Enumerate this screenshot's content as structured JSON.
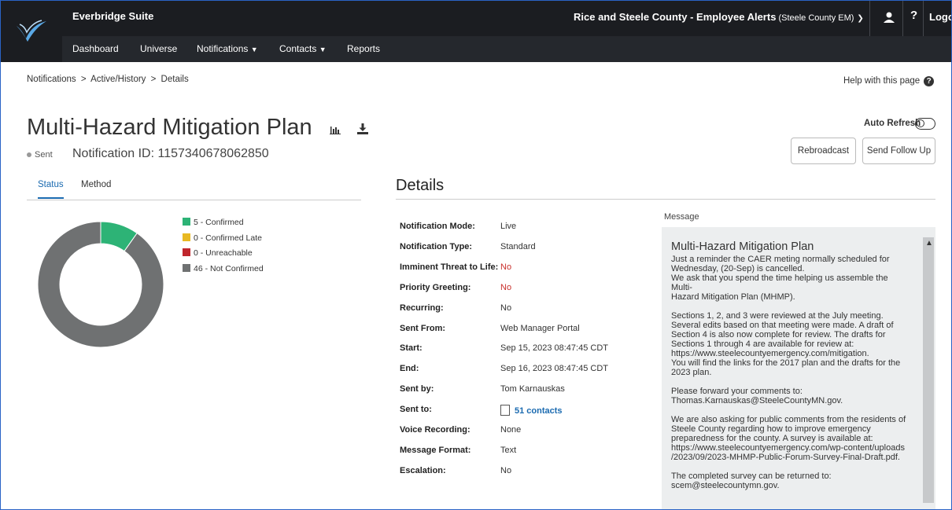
{
  "app": {
    "title": "Everbridge Suite",
    "org_name": "Rice and Steele County - Employee Alerts",
    "org_sub": "(Steele County EM)",
    "help_icon": "?",
    "logout": "Logout"
  },
  "nav": [
    {
      "label": "Dashboard"
    },
    {
      "label": "Universe"
    },
    {
      "label": "Notifications",
      "dropdown": true
    },
    {
      "label": "Contacts",
      "dropdown": true
    },
    {
      "label": "Reports"
    }
  ],
  "breadcrumb": {
    "items": [
      "Notifications",
      "Active/History",
      "Details"
    ],
    "separator": ">"
  },
  "help_page": "Help with this page",
  "header": {
    "title": "Multi-Hazard Mitigation Plan",
    "status": "Sent",
    "notification_id": "Notification ID: 1157340678062850"
  },
  "actions": {
    "auto_refresh": "Auto Refresh",
    "auto_refresh_on": false,
    "rebroadcast": "Rebroadcast",
    "send_follow_up": "Send Follow Up"
  },
  "tabs": {
    "status": "Status",
    "method": "Method"
  },
  "status_chart": {
    "legend": [
      {
        "label": "5 - Confirmed",
        "value": 5,
        "color": "#2db376"
      },
      {
        "label": "0 - Confirmed Late",
        "value": 0,
        "color": "#e8b923"
      },
      {
        "label": "0 - Unreachable",
        "value": 0,
        "color": "#c0262d"
      },
      {
        "label": "46 - Not Confirmed",
        "value": 46,
        "color": "#6f7172"
      }
    ]
  },
  "details": {
    "heading": "Details",
    "rows": [
      {
        "label": "Notification Mode:",
        "value": "Live"
      },
      {
        "label": "Notification Type:",
        "value": "Standard"
      },
      {
        "label": "Imminent Threat to Life:",
        "value": "No",
        "style": "red"
      },
      {
        "label": "Priority Greeting:",
        "value": "No",
        "style": "red"
      },
      {
        "label": "Recurring:",
        "value": "No"
      },
      {
        "label": "Sent From:",
        "value": "Web Manager Portal"
      },
      {
        "label": "Start:",
        "value": "Sep 15, 2023 08:47:45 CDT"
      },
      {
        "label": "End:",
        "value": "Sep 16, 2023 08:47:45 CDT"
      },
      {
        "label": "Sent by:",
        "value": "Tom Karnauskas"
      },
      {
        "label": "Sent to:",
        "value": "51 contacts",
        "style": "link"
      },
      {
        "label": "Voice Recording:",
        "value": "None"
      },
      {
        "label": "Message Format:",
        "value": "Text"
      },
      {
        "label": "Escalation:",
        "value": "No"
      }
    ]
  },
  "message": {
    "label": "Message",
    "title": "Multi-Hazard Mitigation Plan",
    "paragraphs": [
      "Just a reminder the CAER meting normally scheduled for\nWednesday, (20-Sep) is cancelled.\nWe ask that you spend the time helping us assemble the Multi-\nHazard Mitigation Plan (MHMP).",
      "Sections 1, 2, and 3 were reviewed at the July meeting.\nSeveral edits based on that meeting were made. A draft of\nSection 4 is also now complete for review. The drafts for\nSections 1 through 4 are available for review at:\nhttps://www.steelecountyemergency.com/mitigation.\nYou will find the links for the 2017 plan and the drafts for the\n2023 plan.",
      "Please forward your comments to:\nThomas.Karnauskas@SteeleCountyMN.gov.",
      "We are also asking for public comments from the residents of\nSteele County regarding how to improve emergency\npreparedness for the county. A survey is available at:\nhttps://www.steelecountyemergency.com/wp-content/uploads\n/2023/09/2023-MHMP-Public-Forum-Survey-Final-Draft.pdf.",
      "The completed survey can be returned to:\nscem@steelecountymn.gov."
    ]
  },
  "icons": {
    "logo": "everbridge-logo",
    "user": "user-icon",
    "report": "bar-chart-icon",
    "download": "download-icon",
    "help": "help-circle-icon",
    "contacts": "contact-card-icon"
  }
}
